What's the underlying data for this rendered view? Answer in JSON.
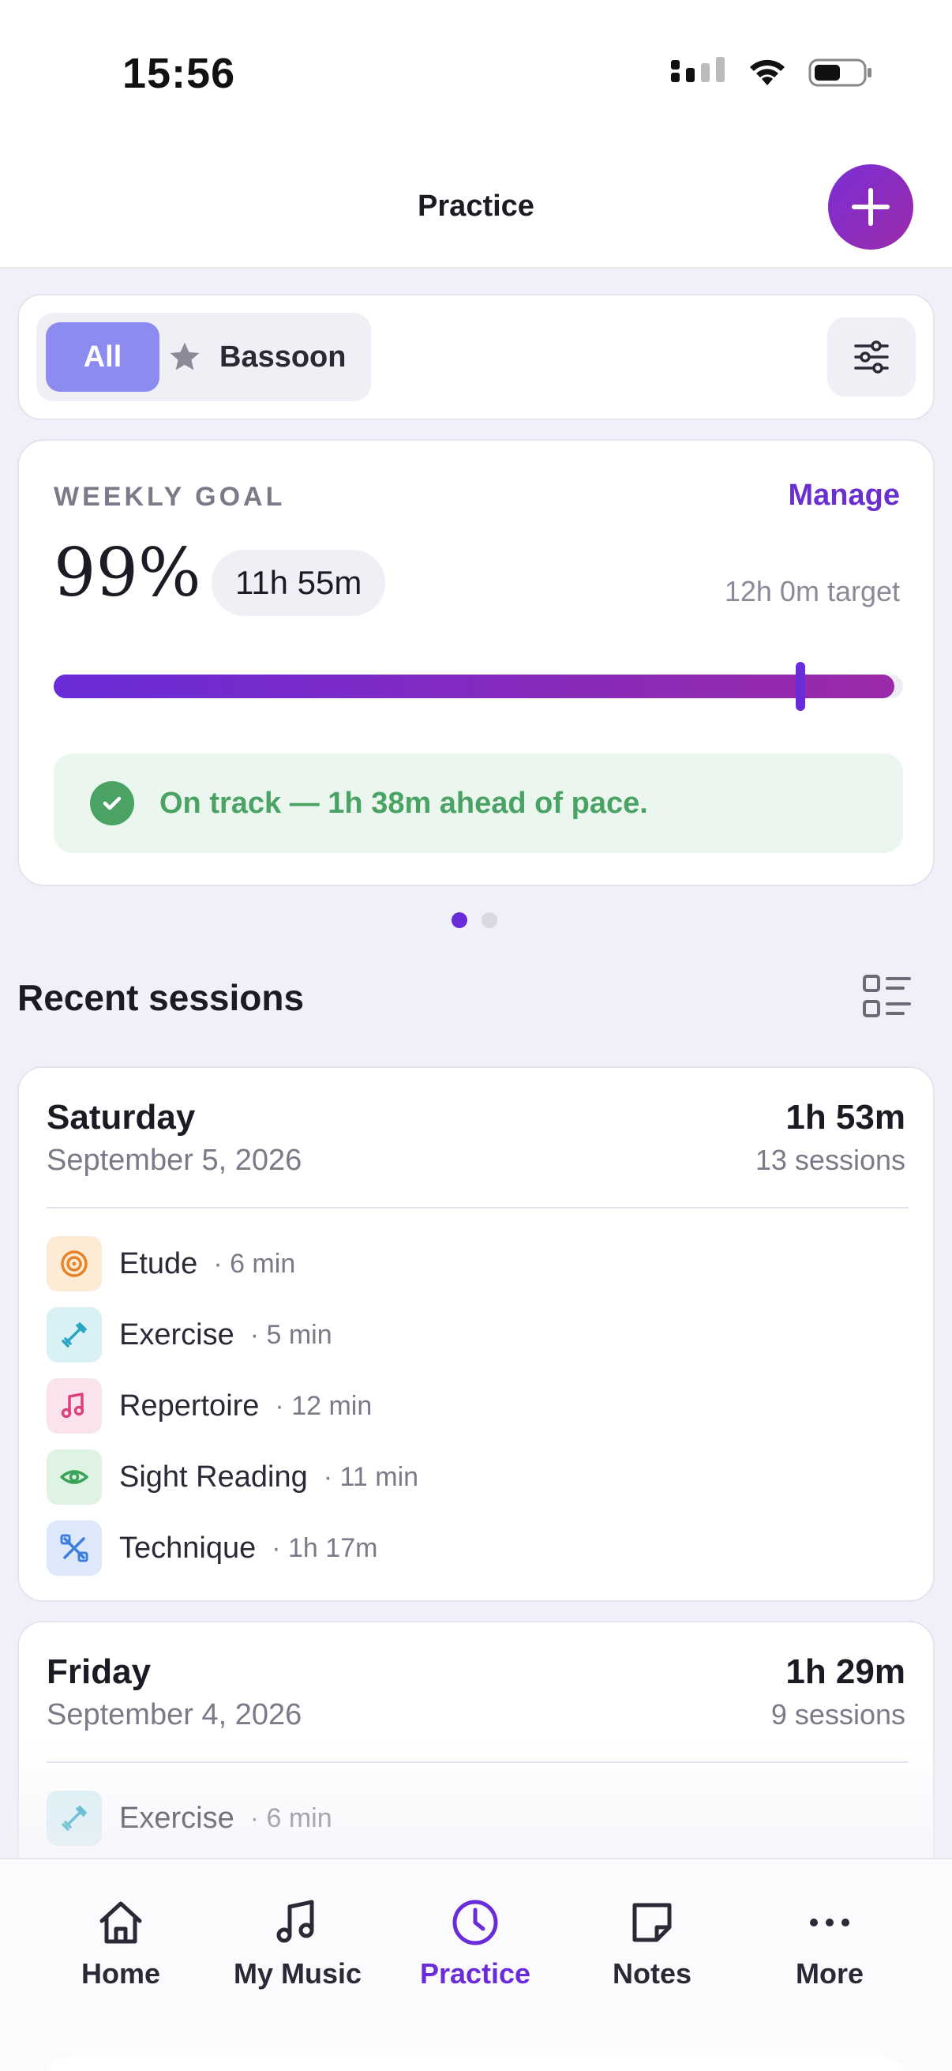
{
  "status_bar": {
    "time": "15:56"
  },
  "header": {
    "title": "Practice"
  },
  "filter": {
    "all_label": "All",
    "instrument_label": "Bassoon"
  },
  "weekly_goal": {
    "label": "WEEKLY GOAL",
    "manage_label": "Manage",
    "percent": "99%",
    "progress_fraction": 0.99,
    "time_done": "11h 55m",
    "target": "12h 0m target",
    "status": "On track — 1h 38m ahead of pace."
  },
  "recent": {
    "title": "Recent sessions",
    "days": [
      {
        "day": "Saturday",
        "date": "September 5, 2026",
        "total": "1h 53m",
        "count": "13 sessions",
        "activities": [
          {
            "name": "Etude",
            "duration": "· 6 min",
            "icon": "target-icon"
          },
          {
            "name": "Exercise",
            "duration": "· 5 min",
            "icon": "dumbbell-icon"
          },
          {
            "name": "Repertoire",
            "duration": "· 12 min",
            "icon": "music-note-icon"
          },
          {
            "name": "Sight Reading",
            "duration": "· 11 min",
            "icon": "eye-icon"
          },
          {
            "name": "Technique",
            "duration": "· 1h 17m",
            "icon": "tools-icon"
          }
        ]
      },
      {
        "day": "Friday",
        "date": "September 4, 2026",
        "total": "1h 29m",
        "count": "9 sessions",
        "activities": [
          {
            "name": "Exercise",
            "duration": "· 6 min",
            "icon": "dumbbell-icon"
          }
        ]
      }
    ]
  },
  "tabs": [
    {
      "label": "Home",
      "icon": "home-icon"
    },
    {
      "label": "My Music",
      "icon": "music-notes-icon"
    },
    {
      "label": "Practice",
      "icon": "clock-icon"
    },
    {
      "label": "Notes",
      "icon": "note-icon"
    },
    {
      "label": "More",
      "icon": "ellipsis-icon"
    }
  ],
  "colors": {
    "accent": "#6a2bd8",
    "success": "#4aa364",
    "chip_all": "#8c8cf0"
  }
}
